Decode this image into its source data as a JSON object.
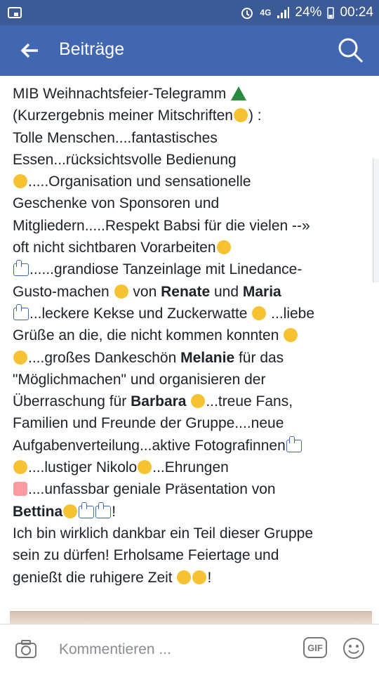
{
  "status_bar": {
    "network": "4G",
    "battery": "24%",
    "time": "00:24"
  },
  "app_bar": {
    "title": "Beiträge"
  },
  "post": {
    "l1": "MIB Weihnachtsfeier-Telegramm",
    "l2a": "(Kurzergebnis meiner Mitschriften",
    "l2b": ") :",
    "l3": "Tolle Menschen....fantastisches",
    "l4": "Essen...rücksichtsvolle  Bedienung",
    "l5": ".....Organisation und sensationelle",
    "l6": "Geschenke von Sponsoren und",
    "l7": "Mitgliedern.....Respekt Babsi für die vielen --»",
    "l8": "oft nicht sichtbaren Vorarbeiten",
    "l9": "......grandiose Tanzeinlage mit Linedance-",
    "l10a": "Gusto-machen",
    "l10b": " von ",
    "l10c": "Renate",
    "l10d": " und ",
    "l10e": "Maria",
    "l11a": "...leckere Kekse und Zuckerwatte",
    "l11b": " ...liebe",
    "l12": "Grüße an die, die nicht kommen konnten",
    "l13a": "....großes Dankeschön  ",
    "l13b": "Melanie",
    "l13c": " für das",
    "l14": "\"Möglichmachen\"  und organisieren der",
    "l15a": "Überraschung für ",
    "l15b": "Barbara",
    "l15c": "...treue Fans,",
    "l16": "Familien und Freunde der Gruppe....neue",
    "l17": "Aufgabenverteilung...aktive Fotografinnen",
    "l18a": "....lustiger Nikolo",
    "l18b": "...Ehrungen",
    "l19": "....unfassbar geniale Präsentation von",
    "l20a": "Bettina",
    "l20b": "!",
    "l21": "Ich bin wirklich dankbar ein Teil dieser Gruppe",
    "l22": "sein zu dürfen! Erholsame Feiertage und",
    "l23a": "genießt die ruhigere Zeit",
    "l23b": "!"
  },
  "composer": {
    "placeholder": "Kommentieren ...",
    "gif_label": "GIF"
  },
  "icons": {
    "back": "arrow-left-icon",
    "search": "search-icon",
    "camera": "camera-icon",
    "smiley": "smiley-icon"
  }
}
